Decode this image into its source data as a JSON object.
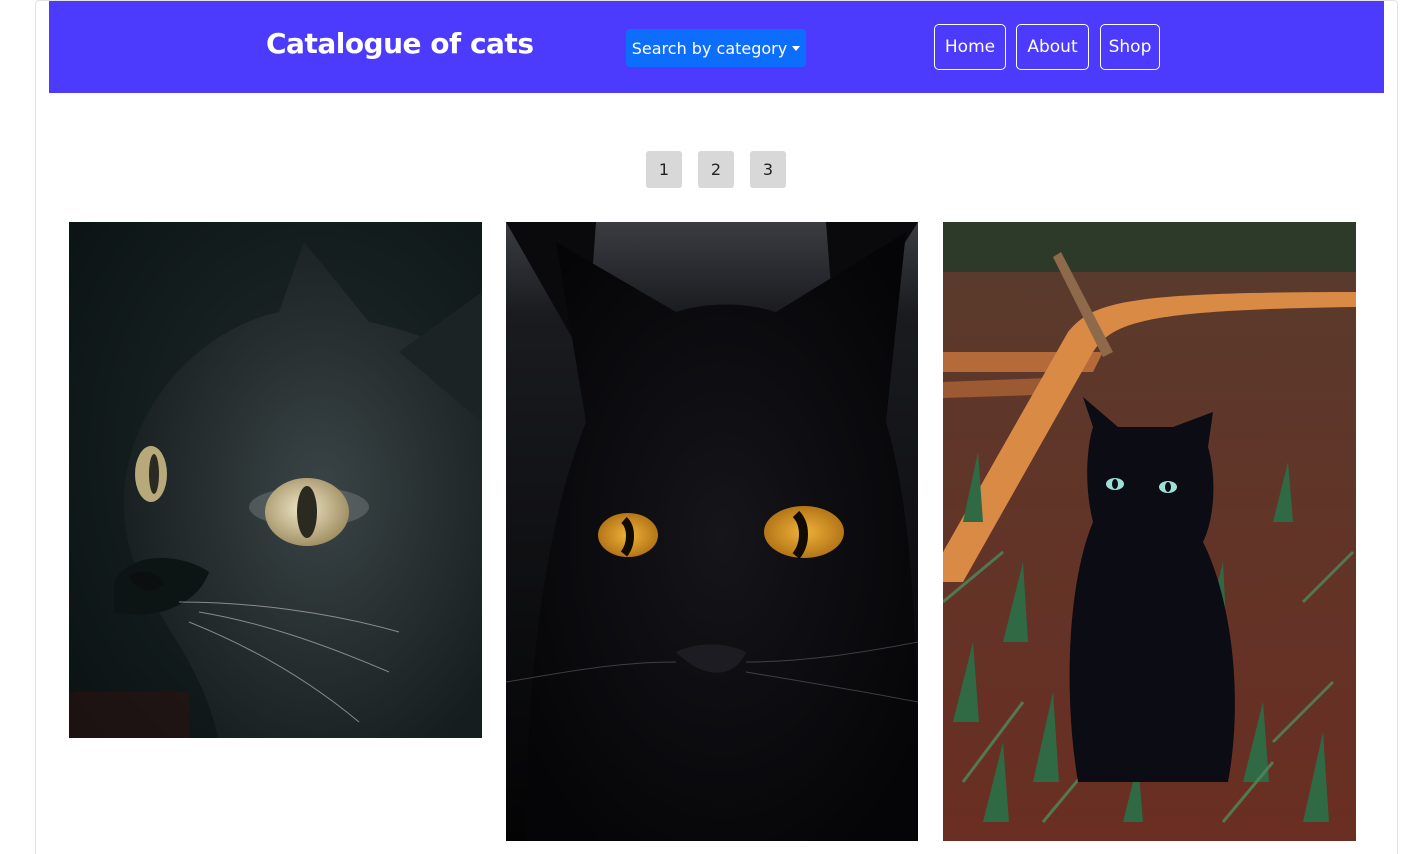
{
  "navbar": {
    "brand": "Catalogue of cats",
    "dropdown_label": "Search by category",
    "links": [
      "Home",
      "About",
      "Shop"
    ],
    "background_color": "#4c3bfd",
    "dropdown_color": "#0d6efd"
  },
  "pagination": {
    "pages": [
      "1",
      "2",
      "3"
    ]
  },
  "gallery": {
    "images": [
      {
        "subject": "black cat close-up side profile",
        "eye_color": "#d6c9a0"
      },
      {
        "subject": "black cat front face dark background",
        "eye_color": "#e3a326"
      },
      {
        "subject": "black cat sitting on red dirt with grass",
        "eye_color": "#9ee0d8"
      }
    ]
  }
}
